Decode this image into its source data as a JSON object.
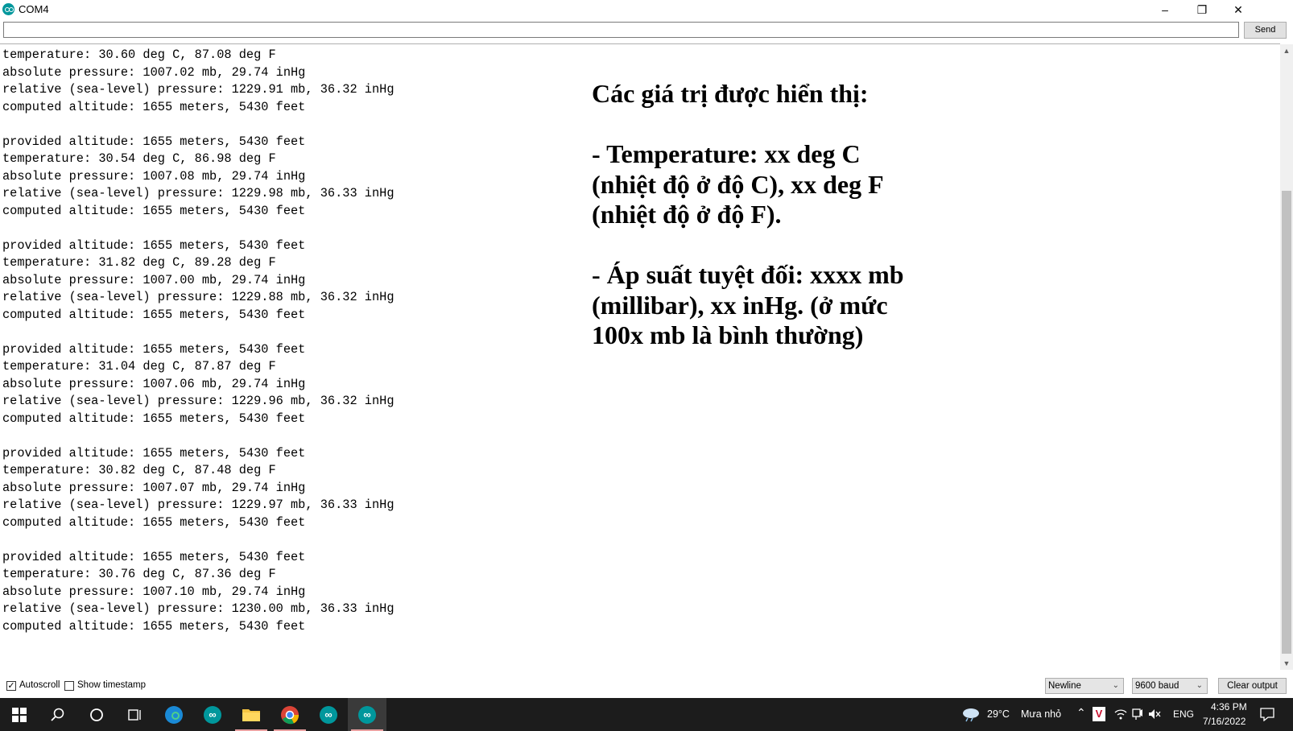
{
  "window": {
    "title": "COM4",
    "minimize_glyph": "–",
    "maximize_glyph": "❐",
    "close_glyph": "✕"
  },
  "send": {
    "input_value": "",
    "button_label": "Send"
  },
  "output_lines": [
    "temperature: 30.60 deg C, 87.08 deg F",
    "absolute pressure: 1007.02 mb, 29.74 inHg",
    "relative (sea-level) pressure: 1229.91 mb, 36.32 inHg",
    "computed altitude: 1655 meters, 5430 feet",
    "",
    "provided altitude: 1655 meters, 5430 feet",
    "temperature: 30.54 deg C, 86.98 deg F",
    "absolute pressure: 1007.08 mb, 29.74 inHg",
    "relative (sea-level) pressure: 1229.98 mb, 36.33 inHg",
    "computed altitude: 1655 meters, 5430 feet",
    "",
    "provided altitude: 1655 meters, 5430 feet",
    "temperature: 31.82 deg C, 89.28 deg F",
    "absolute pressure: 1007.00 mb, 29.74 inHg",
    "relative (sea-level) pressure: 1229.88 mb, 36.32 inHg",
    "computed altitude: 1655 meters, 5430 feet",
    "",
    "provided altitude: 1655 meters, 5430 feet",
    "temperature: 31.04 deg C, 87.87 deg F",
    "absolute pressure: 1007.06 mb, 29.74 inHg",
    "relative (sea-level) pressure: 1229.96 mb, 36.32 inHg",
    "computed altitude: 1655 meters, 5430 feet",
    "",
    "provided altitude: 1655 meters, 5430 feet",
    "temperature: 30.82 deg C, 87.48 deg F",
    "absolute pressure: 1007.07 mb, 29.74 inHg",
    "relative (sea-level) pressure: 1229.97 mb, 36.33 inHg",
    "computed altitude: 1655 meters, 5430 feet",
    "",
    "provided altitude: 1655 meters, 5430 feet",
    "temperature: 30.76 deg C, 87.36 deg F",
    "absolute pressure: 1007.10 mb, 29.74 inHg",
    "relative (sea-level) pressure: 1230.00 mb, 36.33 inHg",
    "computed altitude: 1655 meters, 5430 feet"
  ],
  "annotation": {
    "heading": "Các giá trị được hiển thị:",
    "temp_1": "- Temperature: xx deg C",
    "temp_2": "(nhiệt độ ở độ C), xx deg F",
    "temp_3": "(nhiệt độ ở độ F).",
    "press_1": "- Áp suất tuyệt đối: xxxx mb",
    "press_2": "(millibar), xx inHg. (ở mức",
    "press_3": "100x mb là bình thường)"
  },
  "bottom": {
    "autoscroll_label": "Autoscroll",
    "autoscroll_checked": true,
    "timestamp_label": "Show timestamp",
    "timestamp_checked": false,
    "line_ending": "Newline",
    "baud": "9600 baud",
    "clear_label": "Clear output"
  },
  "taskbar": {
    "weather_temp": "29°C",
    "weather_desc": "Mưa nhỏ",
    "language": "ENG",
    "time": "4:36 PM",
    "date": "7/16/2022",
    "arduino_glyph": "∞"
  },
  "colors": {
    "arduino_teal": "#00979c",
    "taskbar_bg": "#1c1c1c"
  }
}
